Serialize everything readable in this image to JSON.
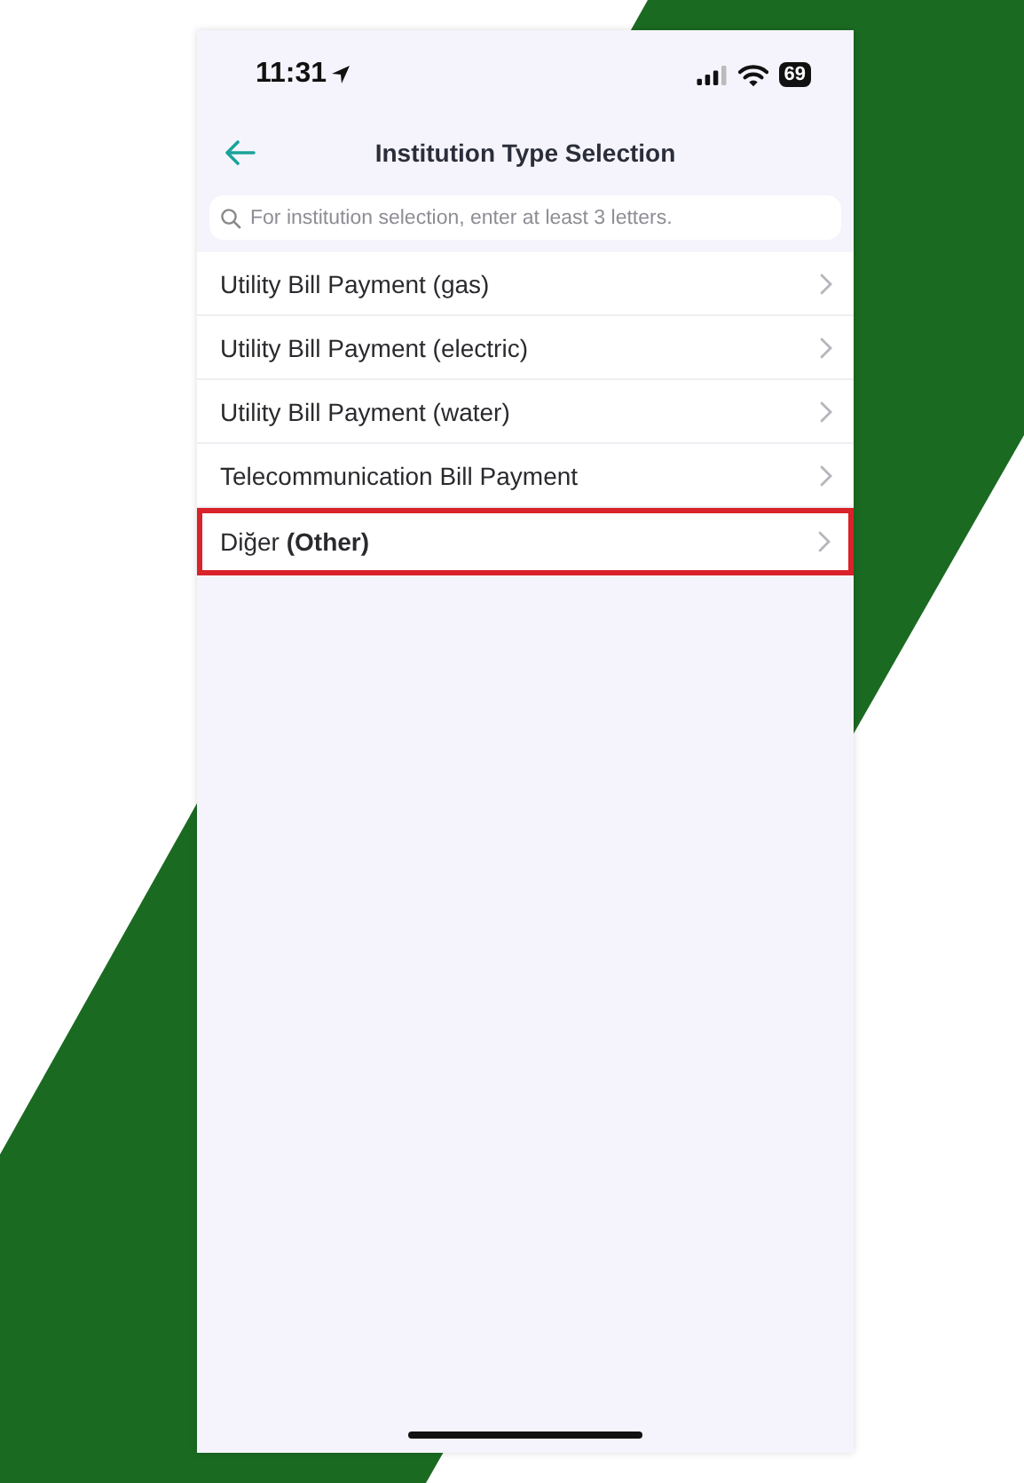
{
  "status_bar": {
    "time": "11:31",
    "battery": "69"
  },
  "header": {
    "title": "Institution Type Selection"
  },
  "search": {
    "placeholder": "For institution selection, enter at least 3 letters."
  },
  "items": [
    {
      "label": "Utility Bill Payment (gas)",
      "highlighted": false
    },
    {
      "label": "Utility Bill Payment (electric)",
      "highlighted": false
    },
    {
      "label": "Utility Bill Payment (water)",
      "highlighted": false
    },
    {
      "label": "Telecommunication Bill Payment",
      "highlighted": false
    },
    {
      "label": "Diğer **(Other)**",
      "highlighted": true
    }
  ]
}
